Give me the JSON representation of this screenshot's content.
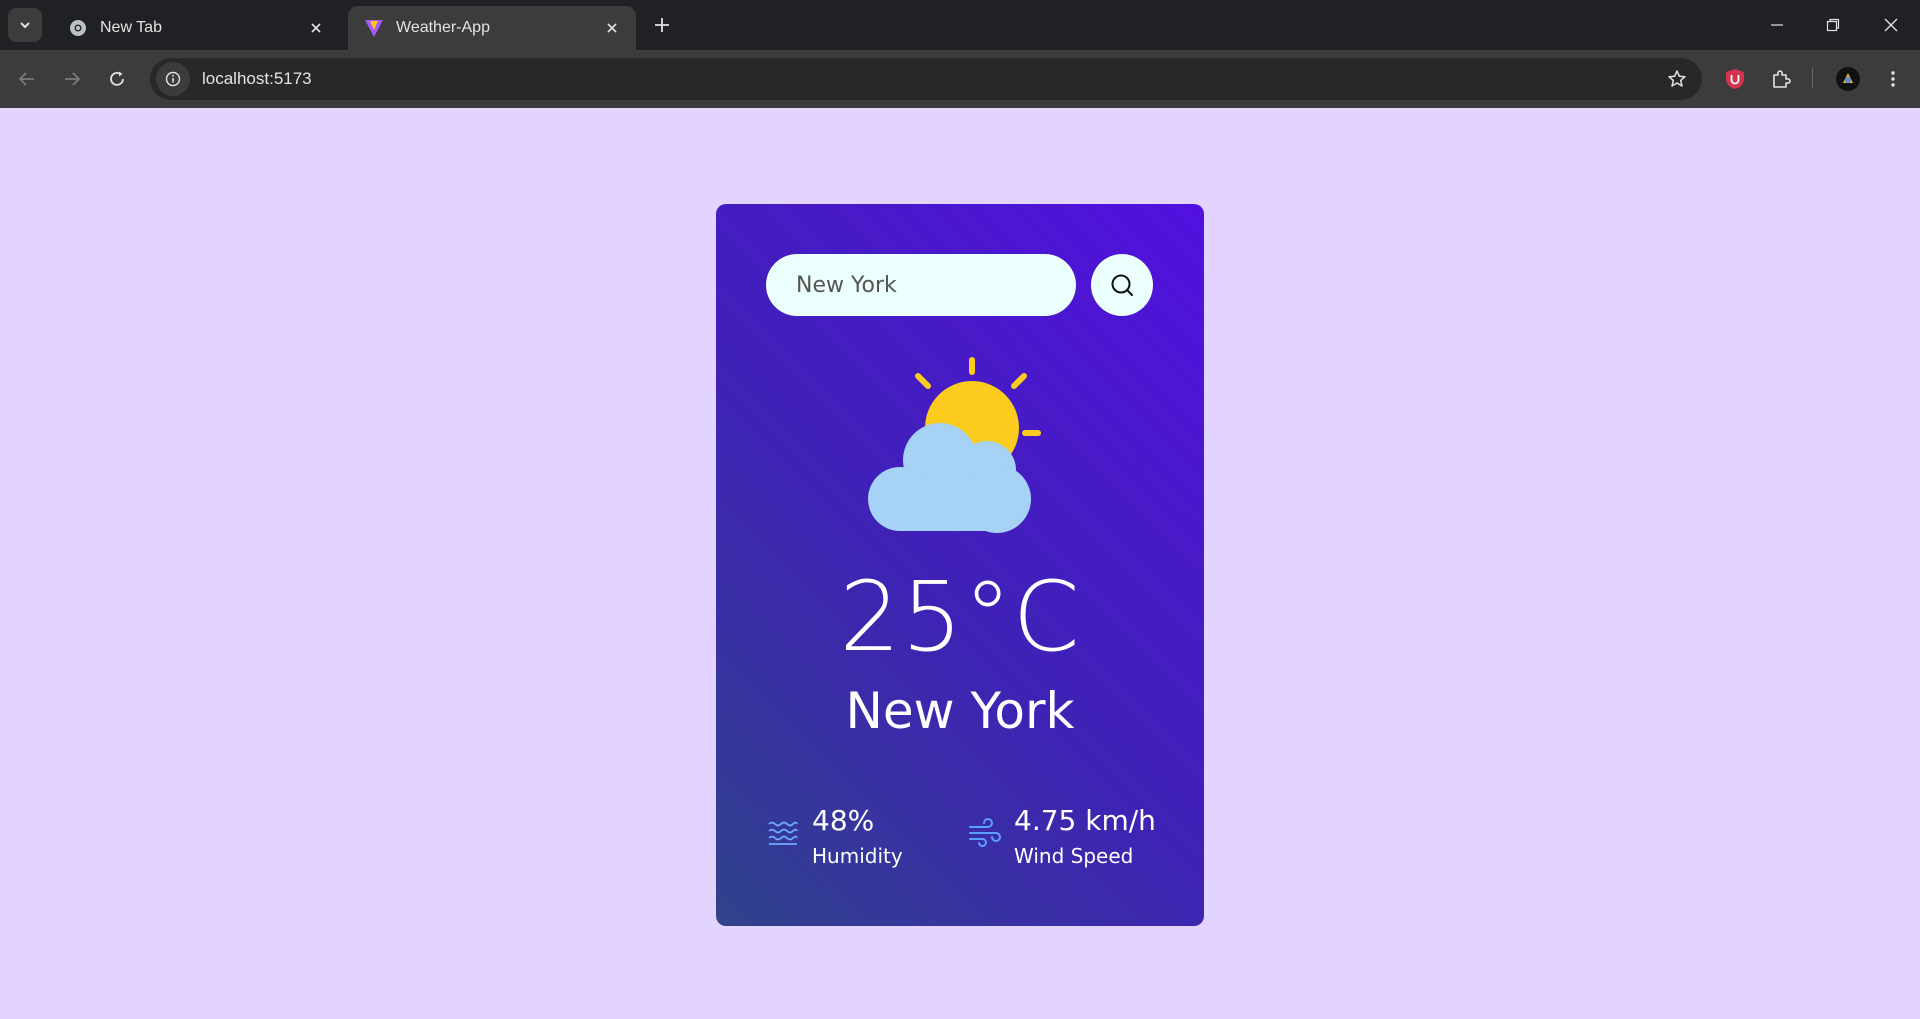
{
  "browser": {
    "tabs": [
      {
        "title": "New Tab",
        "active": false
      },
      {
        "title": "Weather-App",
        "active": true
      }
    ],
    "url": "localhost:5173"
  },
  "weather": {
    "search": {
      "value": "New York",
      "placeholder": "Search"
    },
    "icon": "partly-cloudy-icon",
    "temperature": "25°C",
    "city": "New York",
    "humidity": {
      "value": "48%",
      "label": "Humidity"
    },
    "wind": {
      "value": "4.75 km/h",
      "label": "Wind Speed"
    }
  },
  "colors": {
    "page_bg": "#e2d3ff",
    "card_gradient_top": "#5210e0",
    "card_gradient_bottom": "#2f438a",
    "input_bg": "#ebfffc",
    "sun": "#fbcc1e",
    "cloud": "#a5d2f5"
  }
}
